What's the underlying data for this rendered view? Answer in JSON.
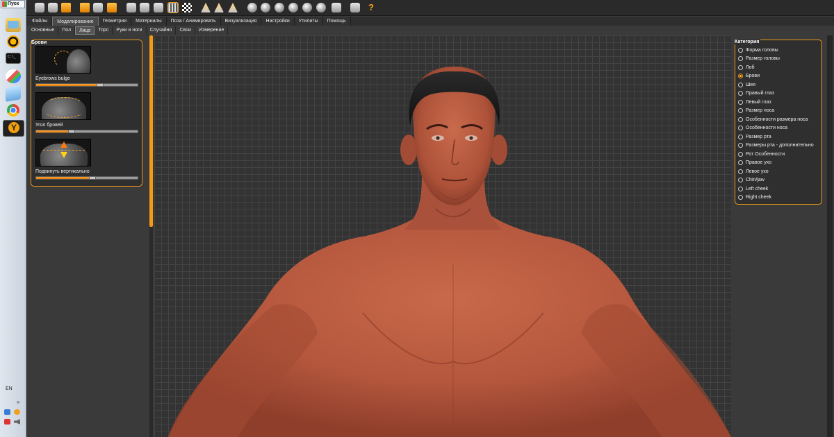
{
  "taskbar": {
    "start_label": "Пуск",
    "language": "EN",
    "tray_chevron": "»",
    "icons": [
      "explorer-icon",
      "avast-icon",
      "cmd-icon",
      "paint-icon",
      "notepad-icon",
      "chrome-icon",
      "makehuman-icon"
    ]
  },
  "toolbar": {
    "icons": [
      "new-icon",
      "save-icon",
      "export-icon",
      "undo-icon",
      "redo-icon",
      "reset-icon",
      "smooth-icon",
      "wireframe-icon",
      "pose-icon",
      "grid-icon",
      "checker-icon",
      "front-view-icon",
      "side-view-icon",
      "top-view-icon",
      "sphere-icon",
      "sphere-icon",
      "sphere-icon",
      "sphere-icon",
      "sphere-icon",
      "sphere-icon",
      "zoom-icon",
      "camera-icon",
      "help-icon"
    ],
    "help_glyph": "?"
  },
  "menu": {
    "tabs": [
      "Файлы",
      "Моделирование",
      "Геометрии",
      "Материалы",
      "Поза / Анимировать",
      "Визуализация",
      "Настройки",
      "Утилиты",
      "Помощь"
    ],
    "active_index": 1
  },
  "submenu": {
    "tabs": [
      "Основные",
      "Пол",
      "Лицо",
      "Торс",
      "Руки и ноги",
      "Случайно",
      "Свои",
      "Измерение"
    ],
    "active_index": 2
  },
  "left_panel": {
    "title": "Брови",
    "sliders": [
      {
        "label": "Eyebrows bulge",
        "value": 0.6
      },
      {
        "label": "Угол бровей",
        "value": 0.32
      },
      {
        "label": "Подвинуть вертикально",
        "value": 0.53
      }
    ]
  },
  "right_panel": {
    "title": "Категория",
    "items": [
      "Форма головы",
      "Размер головы",
      "Лоб",
      "Брови",
      "Шея",
      "Правый глаз",
      "Левый глаз",
      "Размер носа",
      "Особенности размера носа",
      "Особенности носа",
      "Размер рта",
      "Размеры рта - дополнительно",
      "Рот Особенности",
      "Правое ухо",
      "Левое ухо",
      "Chin/jaw",
      "Left cheek",
      "Right cheek"
    ],
    "selected_index": 3
  },
  "colors": {
    "accent": "#f29a16",
    "skin": "#b5573d",
    "viewport_bg": "#333333"
  }
}
